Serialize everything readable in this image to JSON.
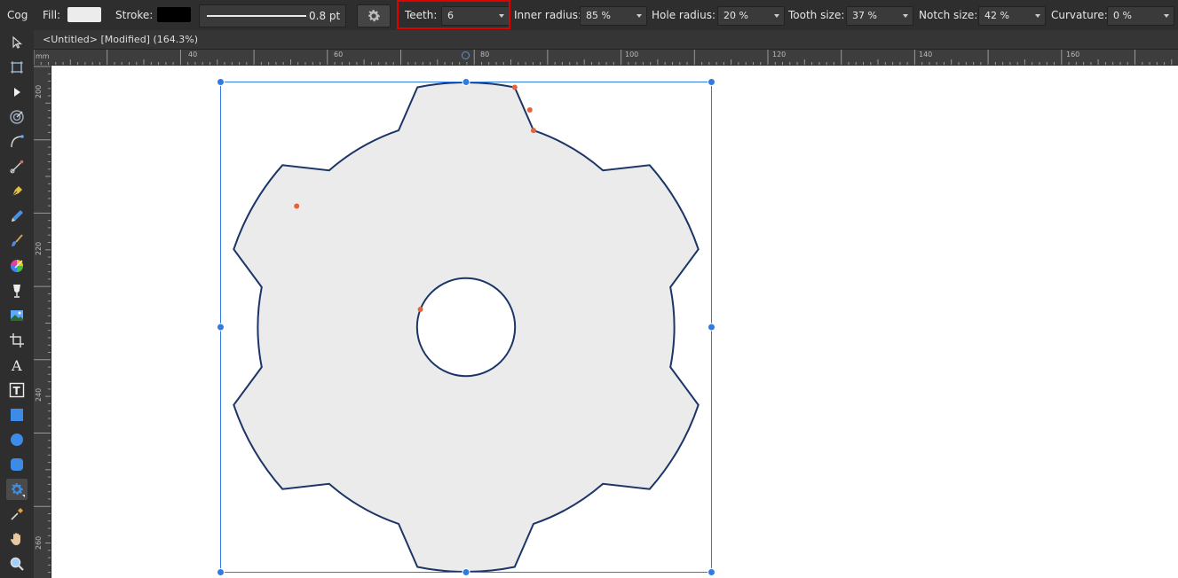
{
  "context_toolbar": {
    "tool_name": "Cog",
    "fill_label": "Fill:",
    "fill_color": "#ececec",
    "stroke_label": "Stroke:",
    "stroke_color": "#000000",
    "stroke_width": "0.8 pt",
    "teeth_label": "Teeth:",
    "teeth_value": "6",
    "inner_radius_label": "Inner radius:",
    "inner_radius_value": "85 %",
    "hole_radius_label": "Hole radius:",
    "hole_radius_value": "20 %",
    "tooth_size_label": "Tooth size:",
    "tooth_size_value": "37 %",
    "notch_size_label": "Notch size:",
    "notch_size_value": "42 %",
    "curvature_label": "Curvature:",
    "curvature_value": "0 %"
  },
  "document": {
    "title": "<Untitled> [Modified] (164.3%)"
  },
  "ruler": {
    "unit": "mm",
    "h_labels": [
      "40",
      "60",
      "80",
      "100",
      "120",
      "140",
      "160"
    ],
    "v_labels": [
      "200",
      "220",
      "240",
      "260"
    ]
  },
  "colors": {
    "highlight": "#e00000",
    "selection": "#2f7be0",
    "node": "#e2643c",
    "shape_fill": "#ebebeb",
    "shape_stroke": "#1b3566"
  },
  "tools": [
    "move-tool",
    "artboard-tool",
    "node-tool",
    "point-transform-tool",
    "corner-tool",
    "pen-tool",
    "pencil-tool",
    "vector-brush-tool",
    "fill-tool",
    "transparency-tool",
    "place-image-tool",
    "crop-tool",
    "artistic-text-tool",
    "frame-text-tool",
    "rectangle-tool",
    "ellipse-tool",
    "rounded-rectangle-tool",
    "cog-tool",
    "color-picker-tool",
    "hand-tool",
    "zoom-tool"
  ]
}
